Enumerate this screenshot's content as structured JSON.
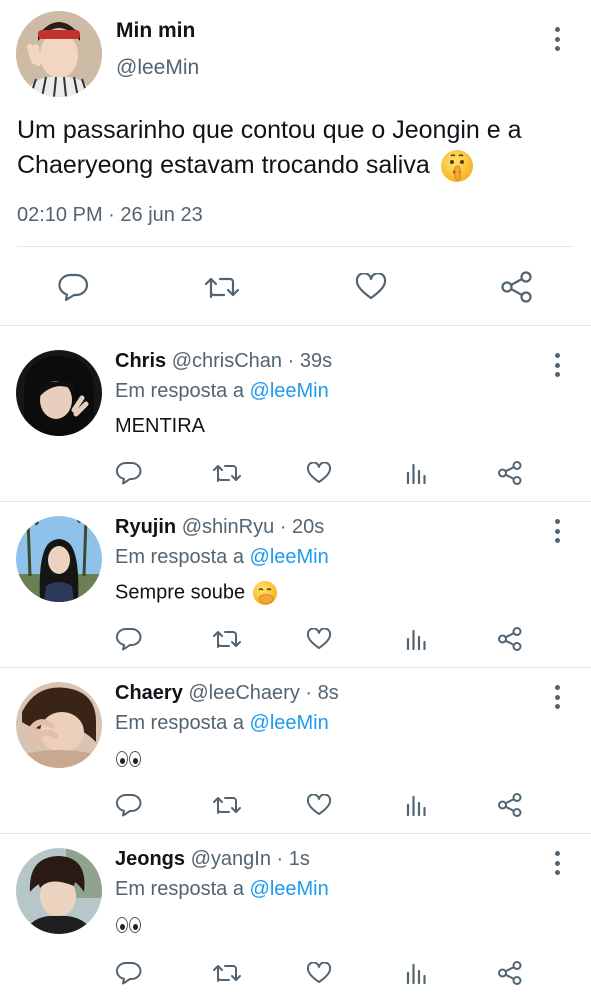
{
  "main_tweet": {
    "name": "Min min",
    "handle": "@leeMin",
    "text": "Um passarinho que contou que o Jeongin e a Chaeryeong estavam trocando saliva",
    "emoji": "shushing-face",
    "time": "02:10 PM",
    "separator": "·",
    "date": "26 jun 23",
    "actions": [
      "reply-icon",
      "retweet-icon",
      "like-icon",
      "share-icon"
    ]
  },
  "replies": [
    {
      "name": "Chris",
      "handle": "@chrisChan",
      "dot": "·",
      "time": "39s",
      "in_reply_prefix": "Em resposta a",
      "mention": "@leeMin",
      "text": "MENTIRA",
      "emoji": ""
    },
    {
      "name": "Ryujin",
      "handle": "@shinRyu",
      "dot": "·",
      "time": "20s",
      "in_reply_prefix": "Em resposta a",
      "mention": "@leeMin",
      "text": "Sempre soube",
      "emoji": "face-with-hand-over-mouth"
    },
    {
      "name": "Chaery",
      "handle": "@leeChaery",
      "dot": "·",
      "time": "8s",
      "in_reply_prefix": "Em resposta a",
      "mention": "@leeMin",
      "text": "",
      "emoji": "eyes"
    },
    {
      "name": "Jeongs",
      "handle": "@yangIn",
      "dot": "·",
      "time": "1s",
      "in_reply_prefix": "Em resposta a",
      "mention": "@leeMin",
      "text": "",
      "emoji": "eyes"
    }
  ],
  "colors": {
    "text": "#0f1419",
    "secondary": "#536471",
    "link": "#1d9bf0",
    "divider": "#e6e9ec",
    "icon": "#536471"
  }
}
